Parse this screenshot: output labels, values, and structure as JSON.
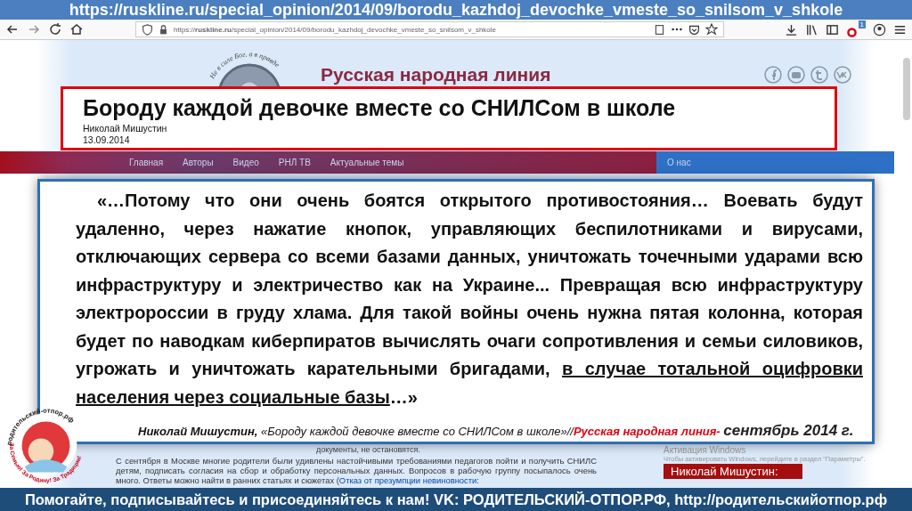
{
  "url_banner": {
    "text": "https://ruskline.ru/special_opinion/2014/09/borodu_kazhdoj_devochke_vmeste_so_snilsom_v_shkole"
  },
  "browser": {
    "address": "https://**ruskline.ru**/special_opinion/2014/09/borodu_kazhdoj_devochke_vmeste_so_snilsom_v_shkole",
    "badge": "1"
  },
  "site": {
    "motto": "Не в силе Бог, а в правде",
    "title": "Русская народная линия",
    "nav": [
      {
        "label": "Главная"
      },
      {
        "label": "Авторы"
      },
      {
        "label": "Видео"
      },
      {
        "label": "РНЛ ТВ"
      },
      {
        "label": "Актуальные темы"
      }
    ],
    "nav_right": "О нас",
    "behind_text": "документы, не остановятся.",
    "article_paragraph": "С сентября в Москве многие родители были удивлены настойчивыми требованиями педагогов пойти и получить СНИЛС детям, подписать согласия на сбор и обработку персональных данных. Вопросов в рабочую группу посыпалось очень много.  Ответы можно найти в ранних статьях и сюжетах (",
    "article_link": "Отказ от презумпции невиновности:",
    "sidebar_box": "Николай Мишустин:",
    "activation_title": "Активация Windows",
    "activation_text": "Чтобы активировать Windows, перейдите в раздел \"Параметры\"."
  },
  "title_card": {
    "title": "Бороду каждой девочке вместе со СНИЛСом в школе",
    "author": "Николай Мишустин",
    "date": "13.09.2014"
  },
  "quote": {
    "text_before": "«…Потому что они очень боятся открытого противостояния… Воевать будут удаленно, через нажатие кнопок, управляющих беспилотниками и вирусами, отключающих сервера со всеми базами данных, уничтожать точечными ударами всю инфраструктуру и электричество как на Украине... Превращая всю инфраструктуру электророссии в груду хлама. Для такой войны очень нужна пятая колонна, которая будет по наводкам киберпиратов вычислять очаги сопротивления и семьи силовиков, угрожать и уничтожать карательными бригадами, ",
    "underlined": "в случае тотальной оцифровки населения через социальные базы",
    "text_after": "…»",
    "citation": [
      {
        "kind": "author",
        "text": "Николай Мишустин,"
      },
      {
        "kind": "title",
        "text": " «Бороду каждой девочке вместе со СНИЛСом в школе»//"
      },
      {
        "kind": "source",
        "text": "Русская народная линия- "
      },
      {
        "kind": "date",
        "text": "сентябрь 2014 г."
      }
    ]
  },
  "sticker": {
    "top_text": "родительский-отпор.рф",
    "bottom_text": "За Семью! За Родину! За Традиции!"
  },
  "bottom_banner": {
    "text": "Помогайте, подписывайтесь и присоединяйтесь к нам! VK: РОДИТЕЛЬСКИЙ-ОТПОР.РФ, http://родительскийотпор.рф"
  }
}
